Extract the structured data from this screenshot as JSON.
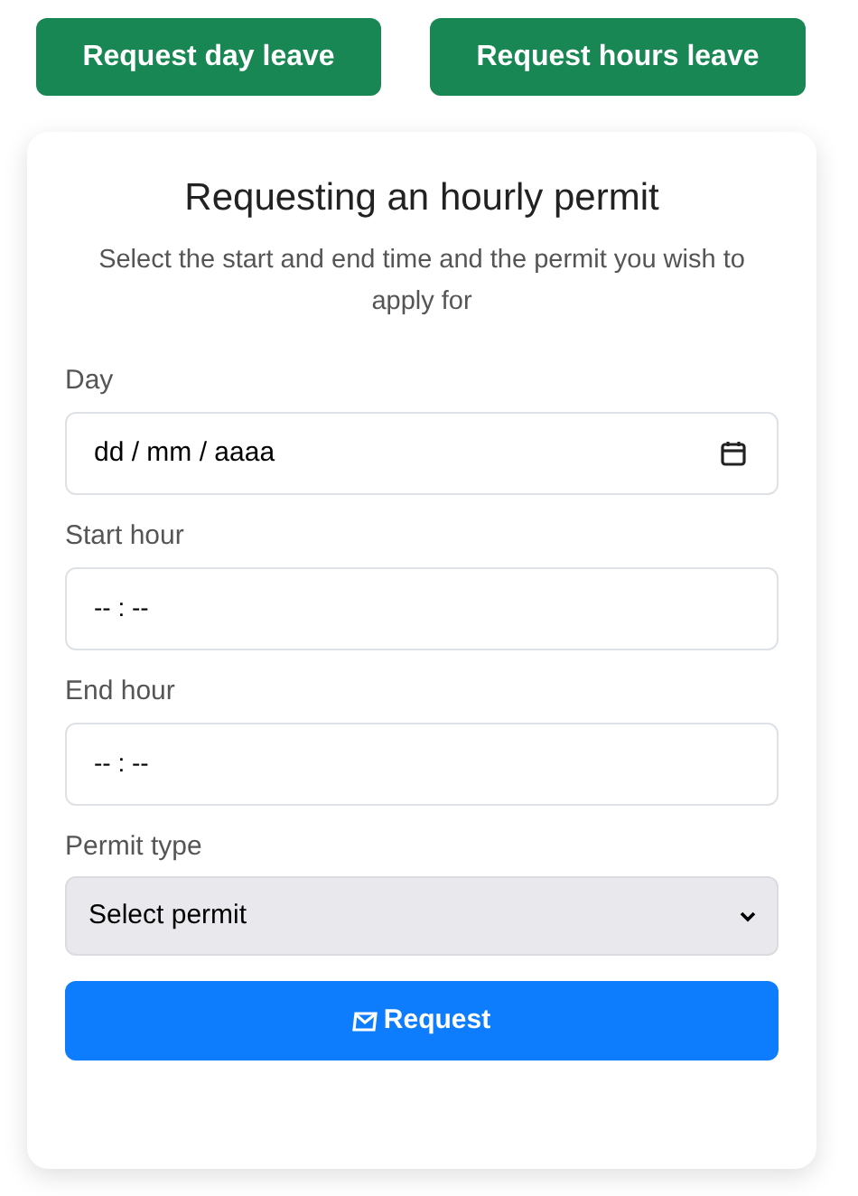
{
  "top_buttons": [
    {
      "label": "Request day leave"
    },
    {
      "label": "Request hours leave"
    }
  ],
  "card": {
    "title": "Requesting an hourly permit",
    "subtitle": "Select the start and end time and the permit you wish to apply for",
    "fields": [
      {
        "kind": "date",
        "label": "Day",
        "placeholder": "dd / mm / aaaa"
      },
      {
        "kind": "time",
        "label": "Start hour",
        "placeholder": "-- : --"
      },
      {
        "kind": "time",
        "label": "End hour",
        "placeholder": "-- : --"
      },
      {
        "kind": "select",
        "label": "Permit type",
        "value": "Select permit"
      }
    ],
    "submit": {
      "label": "Request"
    }
  }
}
